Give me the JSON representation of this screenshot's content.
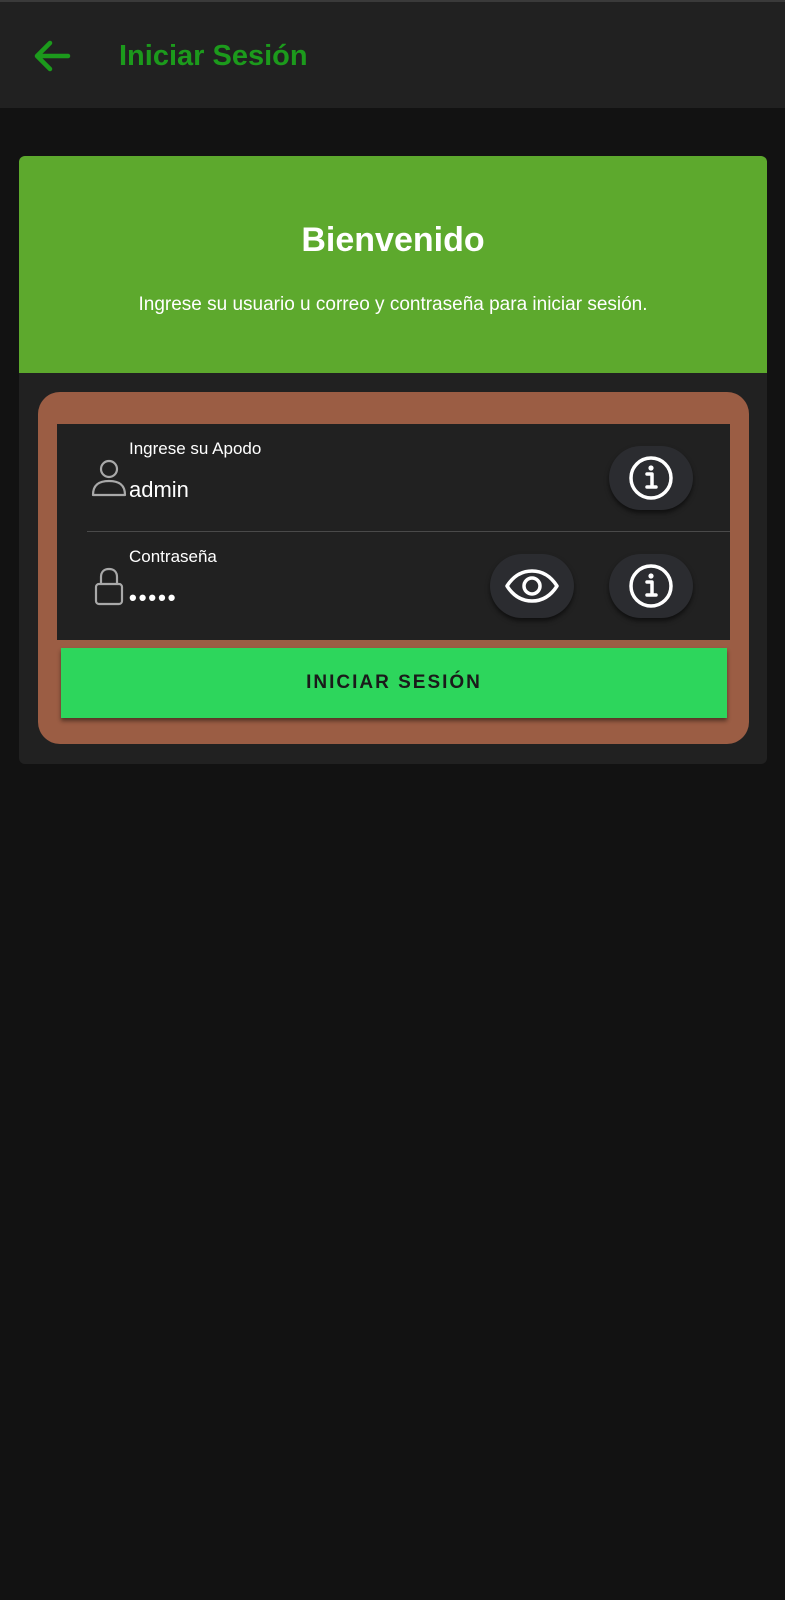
{
  "colors": {
    "accent_green": "#1c9a1c",
    "header_green": "#5da92d",
    "frame_brown": "#9b5d44",
    "button_green": "#2dd65c",
    "background": "#121212",
    "surface": "#212121"
  },
  "appbar": {
    "back_icon": "arrow-left-icon",
    "title": "Iniciar Sesión"
  },
  "card": {
    "title": "Bienvenido",
    "subtitle": "Ingrese su usuario u correo y contraseña para iniciar sesión."
  },
  "form": {
    "username": {
      "icon": "person-icon",
      "label": "Ingrese su Apodo",
      "value": "admin",
      "info_icon": "info-icon"
    },
    "password": {
      "icon": "lock-icon",
      "label": "Contraseña",
      "value": "•••••",
      "visibility_icon": "eye-icon",
      "info_icon": "info-icon"
    },
    "submit_label": "INICIAR SESIÓN"
  }
}
